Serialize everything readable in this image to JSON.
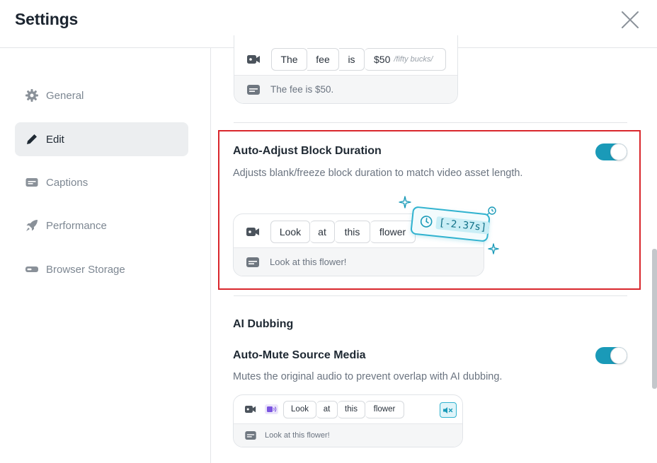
{
  "header": {
    "title": "Settings",
    "close_icon": "close-icon"
  },
  "sidebar": {
    "items": [
      {
        "label": "General",
        "icon": "gear-icon",
        "active": false
      },
      {
        "label": "Edit",
        "icon": "pencil-icon",
        "active": true
      },
      {
        "label": "Captions",
        "icon": "captions-icon",
        "active": false
      },
      {
        "label": "Performance",
        "icon": "rocket-icon",
        "active": false
      },
      {
        "label": "Browser Storage",
        "icon": "storage-icon",
        "active": false
      }
    ]
  },
  "colors": {
    "accent": "#1a9ab8",
    "highlight_border": "#d9262c"
  },
  "example_fee": {
    "words": [
      "The",
      "fee",
      "is",
      "$50"
    ],
    "spoken_note": "/fifty bucks/",
    "caption": "The fee is $50."
  },
  "auto_adjust": {
    "title": "Auto-Adjust Block Duration",
    "description": "Adjusts blank/freeze block duration to match video asset length.",
    "enabled": true,
    "example": {
      "words": [
        "Look",
        "at",
        "this",
        "flower"
      ],
      "caption": "Look at this flower!",
      "duration_badge": "[-2.37s]"
    }
  },
  "ai_dubbing": {
    "section_title": "AI Dubbing",
    "auto_mute": {
      "title": "Auto-Mute Source Media",
      "description": "Mutes the original audio to prevent overlap with AI dubbing.",
      "enabled": true,
      "example": {
        "words": [
          "Look",
          "at",
          "this",
          "flower"
        ],
        "caption": "Look at this flower!"
      }
    }
  }
}
